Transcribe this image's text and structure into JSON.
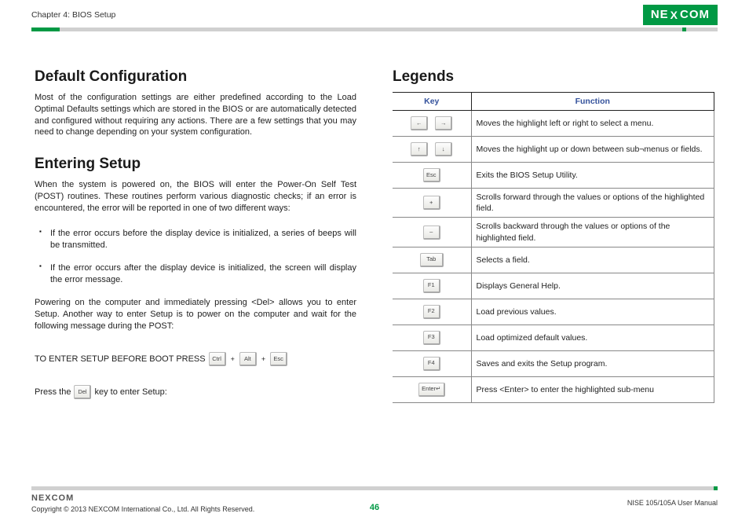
{
  "header": {
    "chapter": "Chapter 4: BIOS Setup",
    "logo_text": "NE COM",
    "logo_x": "X"
  },
  "left": {
    "h1": "Default Configuration",
    "p1": "Most of the configuration settings are either predefined according to the Load Optimal Defaults settings which are stored in the BIOS or are automatically detected and configured without requiring any actions. There are a few settings that you may need to change depending on your system configuration.",
    "h2": "Entering Setup",
    "p2": "When the system is powered on, the BIOS will enter the Power-On Self Test (POST) routines. These routines perform various diagnostic checks; if an error is encountered, the error will be reported in one of two different ways:",
    "b1": "If the error occurs before the display device is initialized, a series of beeps will be transmitted.",
    "b2": "If the error occurs after the display device is initialized, the screen will display the error message.",
    "p3": "Powering on the computer and immediately pressing <Del> allows you to enter Setup. Another way to enter Setup is to power on the computer and wait for the following message during the POST:",
    "setup_label": "TO ENTER SETUP BEFORE BOOT PRESS",
    "k_ctrl": "Ctrl",
    "k_alt": "Alt",
    "k_esc": "Esc",
    "press_pre": "Press the",
    "k_del": "Del",
    "press_post": "key to enter Setup:"
  },
  "right": {
    "h1": "Legends",
    "th_key": "Key",
    "th_func": "Function",
    "rows": {
      "r0": {
        "func": "Moves the highlight left or right to select a menu."
      },
      "r1": {
        "func": "Moves the highlight up or down between sub¬menus or fields."
      },
      "r2": {
        "k": "Esc",
        "func": "Exits the BIOS Setup Utility."
      },
      "r3": {
        "k": "+",
        "func": "Scrolls forward through the values or options of the highlighted field."
      },
      "r4": {
        "k": "–",
        "func": "Scrolls backward through the values or options of the highlighted field."
      },
      "r5": {
        "k": "Tab",
        "func": "Selects a field."
      },
      "r6": {
        "k": "F1",
        "func": "Displays General Help."
      },
      "r7": {
        "k": "F2",
        "func": "Load previous values."
      },
      "r8": {
        "k": "F3",
        "func": "Load optimized default values."
      },
      "r9": {
        "k": "F4",
        "func": "Saves and exits the Setup program."
      },
      "r10": {
        "k": "Enter↵",
        "func": "Press <Enter> to enter the highlighted sub-menu"
      }
    },
    "arrows": {
      "left": "←",
      "right": "→",
      "up": "↑",
      "down": "↓"
    }
  },
  "footer": {
    "logo": "NEXCOM",
    "copyright": "Copyright © 2013 NEXCOM International Co., Ltd. All Rights Reserved.",
    "page": "46",
    "manual": "NISE 105/105A User Manual"
  }
}
